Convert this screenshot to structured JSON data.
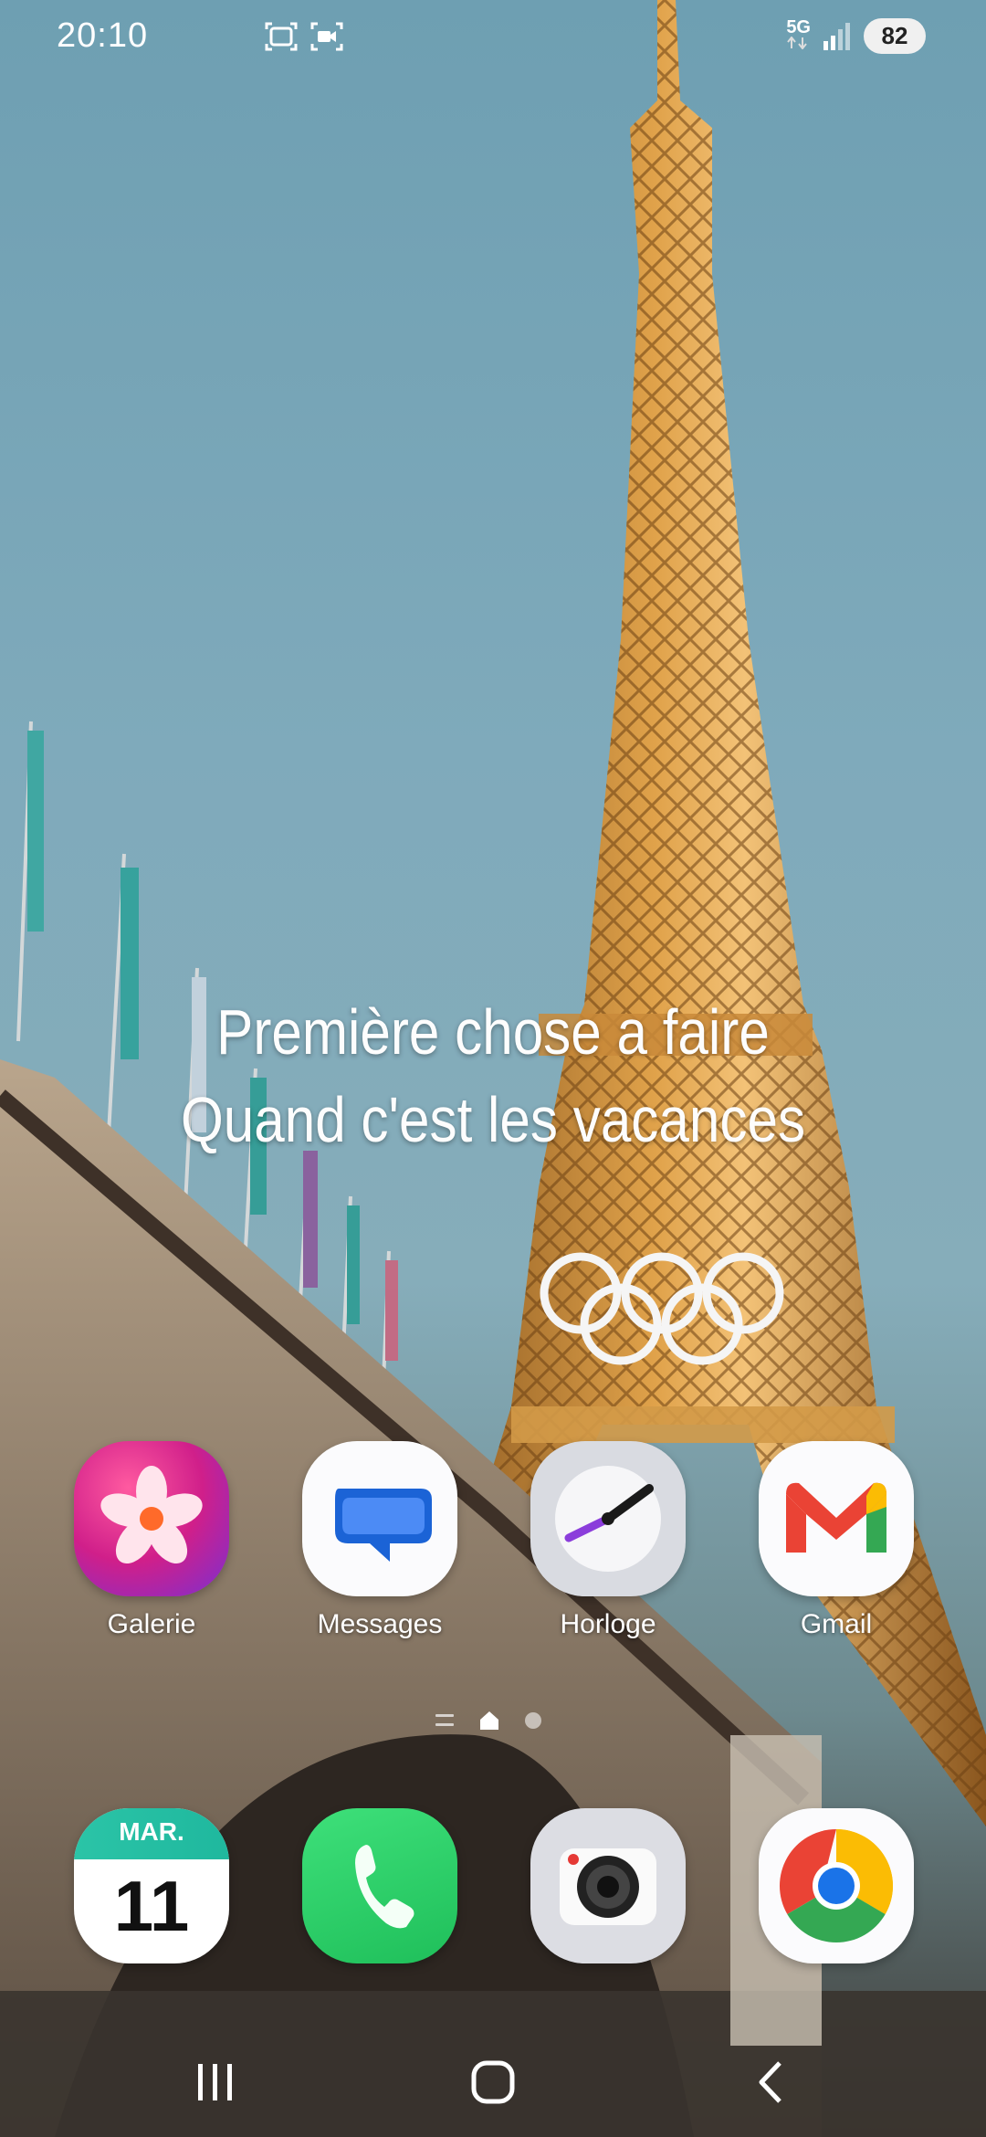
{
  "status_bar": {
    "time": "20:10",
    "network": "5G",
    "battery": "82",
    "icons": [
      "screenshot-icon",
      "screen-record-icon",
      "signal-icon"
    ]
  },
  "wallpaper": {
    "caption_line1": "Première chose a faire",
    "caption_line2": "Quand c'est les vacances"
  },
  "home_apps": [
    {
      "label": "Galerie",
      "icon": "gallery-icon"
    },
    {
      "label": "Messages",
      "icon": "messages-icon"
    },
    {
      "label": "Horloge",
      "icon": "clock-icon"
    },
    {
      "label": "Gmail",
      "icon": "gmail-icon"
    }
  ],
  "dock": {
    "calendar": {
      "month": "MAR.",
      "day": "11",
      "icon": "calendar-icon"
    },
    "phone": {
      "icon": "phone-icon"
    },
    "camera": {
      "icon": "camera-icon"
    },
    "chrome": {
      "icon": "chrome-icon"
    }
  },
  "page_indicator": {
    "pages": 3,
    "current": 1
  },
  "nav": {
    "icons": [
      "recents-icon",
      "home-icon",
      "back-icon"
    ]
  }
}
